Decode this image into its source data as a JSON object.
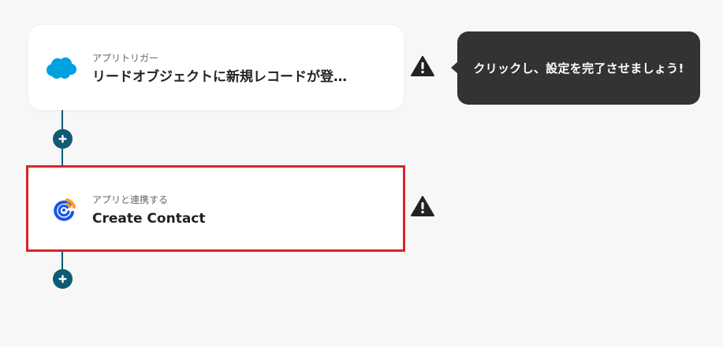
{
  "flow": {
    "steps": [
      {
        "subtitle": "アプリトリガー",
        "title": "リードオブジェクトに新規レコードが登…",
        "icon": "salesforce-cloud-icon",
        "has_warning": true
      },
      {
        "subtitle": "アプリと連携する",
        "title": "Create Contact",
        "icon": "constant-contact-icon",
        "has_warning": true,
        "highlighted": true
      }
    ],
    "add_step_icon": "plus-icon",
    "warning_icon": "warning-triangle-icon"
  },
  "tooltip": {
    "text": "クリックし、設定を完了させましょう!"
  },
  "colors": {
    "connector": "#0e5b73",
    "highlight_border": "#d9242b",
    "tooltip_bg": "#333333",
    "salesforce_blue": "#00a1e0",
    "constant_contact_blue": "#1856ed",
    "constant_contact_orange": "#ff9e1a"
  }
}
